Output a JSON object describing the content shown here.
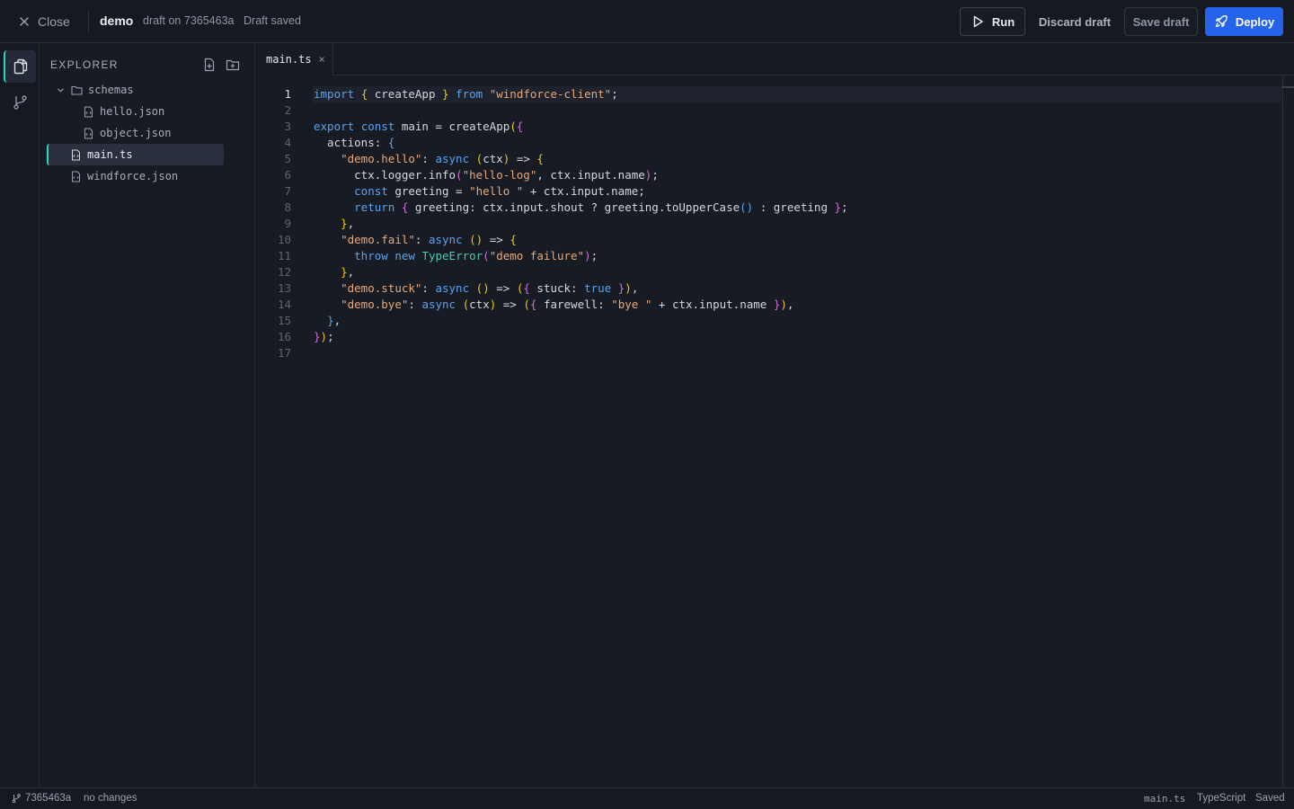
{
  "header": {
    "close_label": "Close",
    "app_name": "demo",
    "draft_info": "draft on 7365463a",
    "draft_status": "Draft saved",
    "run_label": "Run",
    "discard_label": "Discard draft",
    "save_label": "Save draft",
    "deploy_label": "Deploy",
    "accent_color": "#2563eb"
  },
  "activity_bar": {
    "items": [
      {
        "icon": "files-icon",
        "active": true
      },
      {
        "icon": "git-branch-icon",
        "active": false
      }
    ],
    "active_color": "#2dd4bf"
  },
  "explorer": {
    "title": "EXPLORER",
    "actions": [
      "new-file-icon",
      "new-folder-icon"
    ],
    "tree": [
      {
        "label": "schemas",
        "type": "folder",
        "expanded": true
      },
      {
        "label": "hello.json",
        "type": "file"
      },
      {
        "label": "object.json",
        "type": "file"
      },
      {
        "label": "main.ts",
        "type": "file",
        "selected": true
      },
      {
        "label": "windforce.json",
        "type": "file"
      }
    ]
  },
  "editor": {
    "tabs": [
      {
        "label": "main.ts",
        "close": "×",
        "active": true
      }
    ],
    "active_line": 1,
    "language": "typescript",
    "lines": [
      "import { createApp } from \"windforce-client\";",
      "",
      "export const main = createApp({",
      "  actions: {",
      "    \"demo.hello\": async (ctx) => {",
      "      ctx.logger.info(\"hello-log\", ctx.input.name);",
      "      const greeting = \"hello \" + ctx.input.name;",
      "      return { greeting: ctx.input.shout ? greeting.toUpperCase() : greeting };",
      "    },",
      "    \"demo.fail\": async () => {",
      "      throw new TypeError(\"demo failure\");",
      "    },",
      "    \"demo.stuck\": async () => ({ stuck: true }),",
      "    \"demo.bye\": async (ctx) => ({ farewell: \"bye \" + ctx.input.name }),",
      "  },",
      "});",
      ""
    ]
  },
  "statusbar": {
    "branch": "7365463a",
    "changes": "no changes",
    "file": "main.ts",
    "language": "TypeScript",
    "save_state": "Saved"
  }
}
